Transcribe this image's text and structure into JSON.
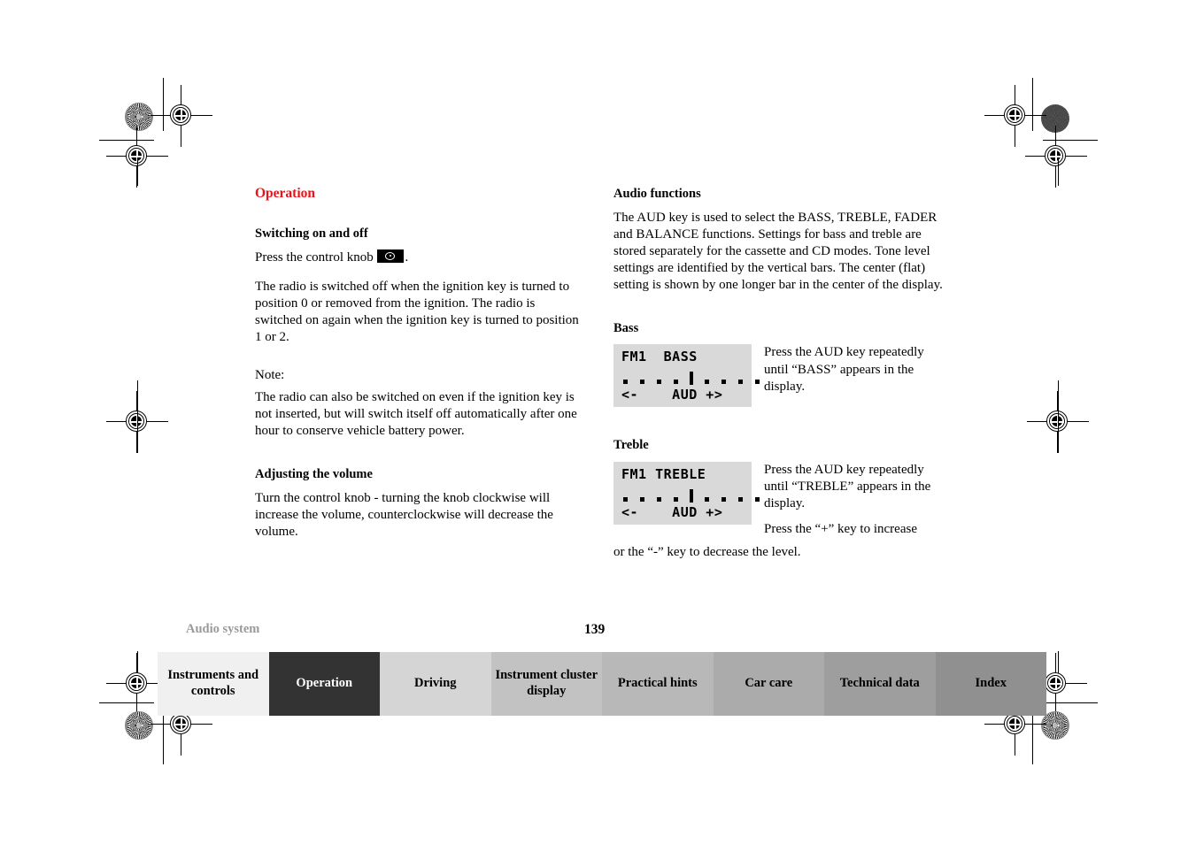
{
  "document": {
    "section_title": "Operation",
    "chapter_label": "Audio system",
    "page_number": "139"
  },
  "left_column": {
    "heading_switching": "Switching on and off",
    "press_knob_prefix": "Press the control knob",
    "press_knob_suffix": ".",
    "knob_icon": "rotary-knob-icon",
    "para_ignition": "The radio is switched off when the ignition key is turned to position 0 or removed from the ignition. The radio is switched on again when the ignition key is turned to position 1 or 2.",
    "note_label": "Note:",
    "note_text": "The radio can also be switched on even if the ignition key is not inserted, but will switch itself off automatically after one hour to conserve vehicle battery power.",
    "heading_volume": "Adjusting the volume",
    "para_volume": "Turn the control knob - turning the knob clockwise will increase the volume, counterclockwise will decrease the volume."
  },
  "right_column": {
    "heading_audio_functions": "Audio functions",
    "para_audio_functions": "The AUD key is used to select the BASS, TREBLE, FADER and BALANCE functions. Settings for bass and treble are stored separately for the cassette and CD modes. Tone level settings are identified by the vertical bars. The center (flat) setting is shown by one longer bar in the center of the display.",
    "heading_bass": "Bass",
    "bass_display": {
      "line1_mode": "FM1",
      "line1_function": "BASS",
      "line1": "FM1  BASS",
      "line3": "<-    AUD +>",
      "bar_count_left": 4,
      "bar_count_right": 4,
      "center_bar": true,
      "background_color": "#d9d9d9"
    },
    "bass_instruction": "Press the AUD key repeatedly until “BASS” appears in the display.",
    "heading_treble": "Treble",
    "treble_display": {
      "line1_mode": "FM1",
      "line1_function": "TREBLE",
      "line1": "FM1 TREBLE",
      "line3": "<-    AUD +>",
      "bar_count_left": 4,
      "bar_count_right": 4,
      "center_bar": true,
      "background_color": "#d9d9d9"
    },
    "treble_instruction": "Press the AUD key repeatedly until “TREBLE” appears in the display.",
    "level_instruction_part1": "Press the “+” key to increase",
    "level_instruction_part2": "or the “-” key to decrease the level."
  },
  "tabs": [
    {
      "label": "Instruments and controls",
      "bg": "#f0f0f0",
      "fg": "#000000",
      "active": false
    },
    {
      "label": "Operation",
      "bg": "#333333",
      "fg": "#ffffff",
      "active": true
    },
    {
      "label": "Driving",
      "bg": "#d5d5d5",
      "fg": "#000000",
      "active": false
    },
    {
      "label": "Instrument cluster display",
      "bg": "#c2c2c2",
      "fg": "#000000",
      "active": false
    },
    {
      "label": "Practical hints",
      "bg": "#b8b8b8",
      "fg": "#000000",
      "active": false
    },
    {
      "label": "Car care",
      "bg": "#ababab",
      "fg": "#000000",
      "active": false
    },
    {
      "label": "Technical data",
      "bg": "#9e9e9e",
      "fg": "#000000",
      "active": false
    },
    {
      "label": "Index",
      "bg": "#909090",
      "fg": "#000000",
      "active": false
    }
  ],
  "colors": {
    "accent_red": "#e8131a",
    "chapter_gray": "#9a9a9a",
    "lcd_gray": "#d9d9d9"
  }
}
